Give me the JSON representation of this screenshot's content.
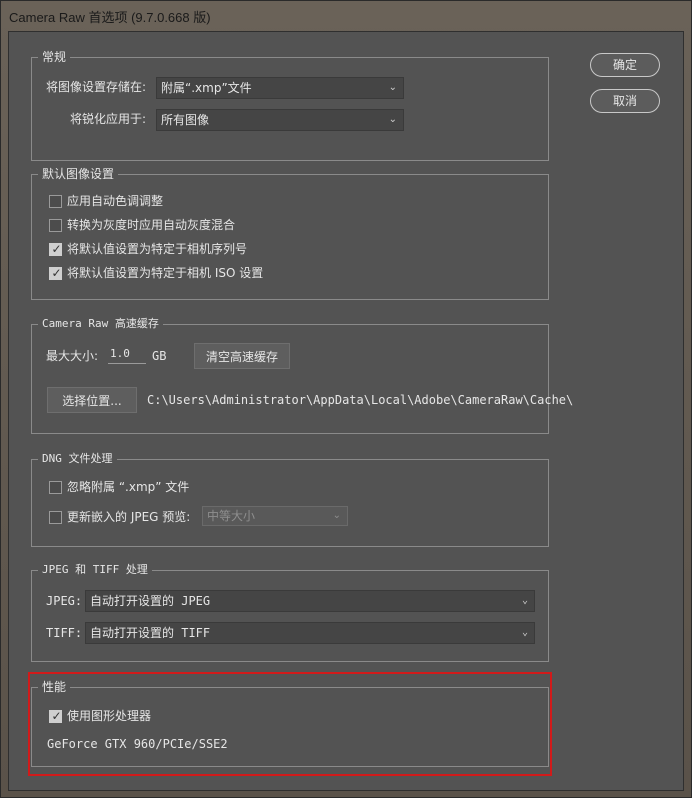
{
  "window": {
    "title": "Camera Raw 首选项 (9.7.0.668 版)"
  },
  "buttons": {
    "ok": "确定",
    "cancel": "取消"
  },
  "general": {
    "legend": "常规",
    "save_label": "将图像设置存储在:",
    "save_value": "附属“.xmp”文件",
    "sharpen_label": "将锐化应用于:",
    "sharpen_value": "所有图像"
  },
  "defaults": {
    "legend": "默认图像设置",
    "items": [
      {
        "label": "应用自动色调调整",
        "checked": false
      },
      {
        "label": "转换为灰度时应用自动灰度混合",
        "checked": false
      },
      {
        "label": "将默认值设置为特定于相机序列号",
        "checked": true
      },
      {
        "label": "将默认值设置为特定于相机 ISO 设置",
        "checked": true
      }
    ]
  },
  "cache": {
    "legend": "Camera Raw 高速缓存",
    "max_size_label": "最大大小:",
    "max_size_value": "1.0",
    "unit": "GB",
    "purge_button": "清空高速缓存",
    "select_location_button": "选择位置...",
    "path": "C:\\Users\\Administrator\\AppData\\Local\\Adobe\\CameraRaw\\Cache\\"
  },
  "dng": {
    "legend": "DNG 文件处理",
    "ignore_label": "忽略附属 “.xmp” 文件",
    "update_label": "更新嵌入的 JPEG 预览:",
    "preview_value": "中等大小"
  },
  "jpeg_tiff": {
    "legend": "JPEG 和 TIFF 处理",
    "jpeg_label": "JPEG:",
    "jpeg_value": "自动打开设置的 JPEG",
    "tiff_label": "TIFF:",
    "tiff_value": "自动打开设置的 TIFF"
  },
  "performance": {
    "legend": "性能",
    "gpu_label": "使用图形处理器",
    "gpu_checked": true,
    "gpu_info": "GeForce GTX 960/PCIe/SSE2"
  },
  "colors": {
    "highlight": "#d11a1a",
    "panel": "#535353"
  }
}
